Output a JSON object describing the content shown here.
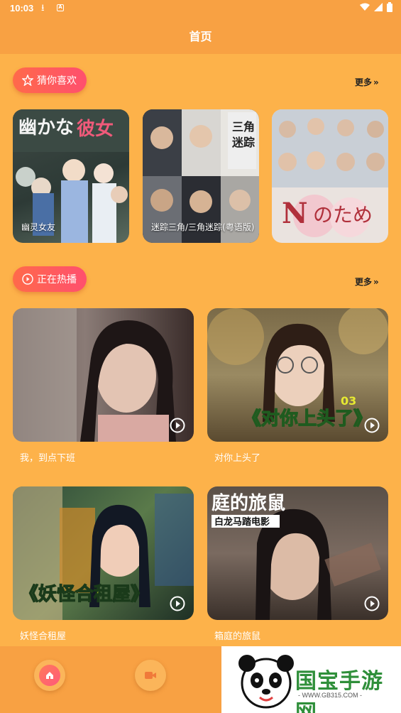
{
  "status_bar": {
    "time": "10:03"
  },
  "header": {
    "title": "首页"
  },
  "guess_section": {
    "label": "猜你喜欢",
    "more": "更多"
  },
  "guess_items": [
    {
      "title": "幽灵女友",
      "poster_text": "幽かな彼女"
    },
    {
      "title": "迷踪三角/三角迷踪(粤语版)",
      "poster_text": "三角迷踪"
    },
    {
      "title": "",
      "poster_text": "Nのため"
    }
  ],
  "hot_section": {
    "label": "正在热播",
    "more": "更多"
  },
  "hot_items": [
    {
      "title": "我，到点下班",
      "overlay": ""
    },
    {
      "title": "对你上头了",
      "overlay": "《对你上头了》",
      "badge": "03"
    },
    {
      "title": "妖怪合租屋",
      "overlay": "《妖怪合租屋》"
    },
    {
      "title": "箱庭的旅鼠",
      "overlay": "庭的旅鼠",
      "sub_overlay": "白龙马踏电影"
    }
  ],
  "watermark": {
    "text": "国宝手游网",
    "url": "- WWW.GB315.COM -"
  },
  "colors": {
    "background": "#fdb24a",
    "header": "#f8a143",
    "pill": "#ff5a5a"
  }
}
